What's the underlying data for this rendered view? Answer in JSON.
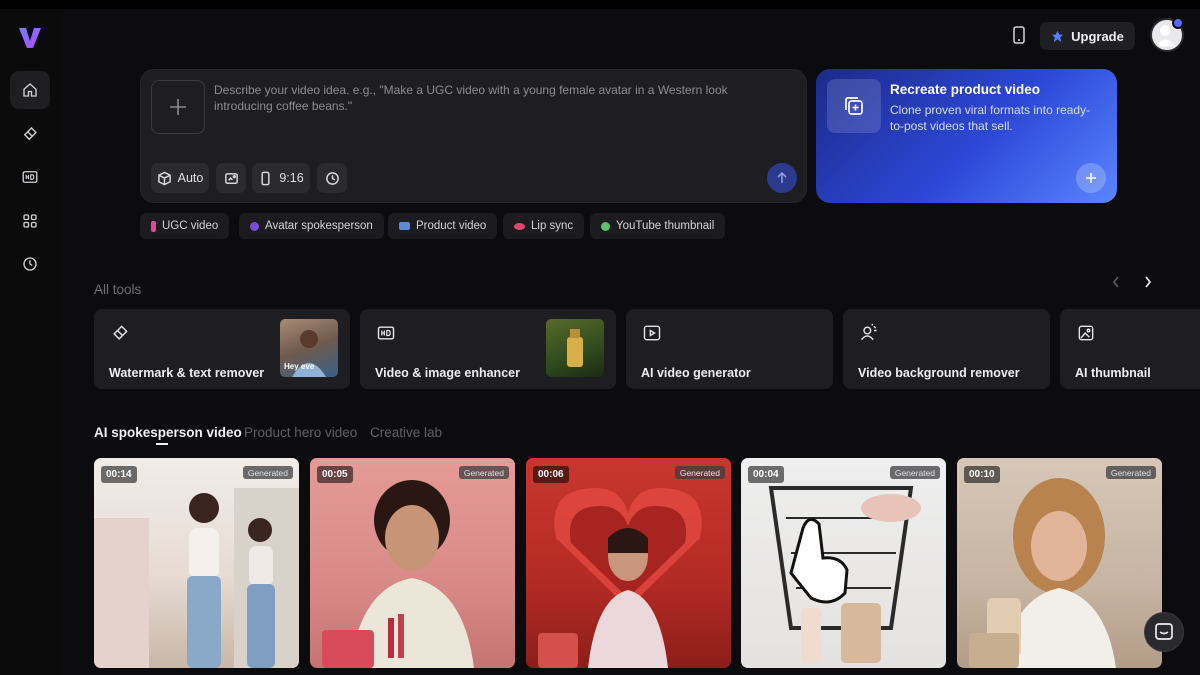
{
  "app": {
    "logo_letter": "V",
    "accent": "#6a5cff"
  },
  "rail": {
    "items": [
      "home-icon",
      "eraser-icon",
      "hd-icon",
      "grid-icon",
      "history-icon"
    ]
  },
  "header": {
    "upgrade_label": "Upgrade"
  },
  "prompt": {
    "placeholder": "Describe your video idea. e.g., \"Make a UGC video with a young female avatar in a Western look introducing coffee beans.\"",
    "chips": {
      "mode": "Auto",
      "ratio": "9:16"
    }
  },
  "recreate": {
    "title": "Recreate product video",
    "desc": "Clone proven viral formats into ready-to-post videos that sell."
  },
  "quick": [
    "UGC video",
    "Avatar spokesperson",
    "Product video",
    "Lip sync",
    "YouTube thumbnail"
  ],
  "tools_section": {
    "label": "All tools"
  },
  "tools": [
    "Watermark & text remover",
    "Video & image enhancer",
    "AI video generator",
    "Video background remover",
    "AI thumbnail"
  ],
  "thumb_caption": "Hey eve",
  "tabs": [
    "AI spokesperson video",
    "Product hero video",
    "Creative lab"
  ],
  "videos": [
    {
      "duration": "00:14",
      "badge": "Generated"
    },
    {
      "duration": "00:05",
      "badge": "Generated"
    },
    {
      "duration": "00:06",
      "badge": "Generated"
    },
    {
      "duration": "00:04",
      "badge": "Generated"
    },
    {
      "duration": "00:10",
      "badge": "Generated"
    }
  ]
}
